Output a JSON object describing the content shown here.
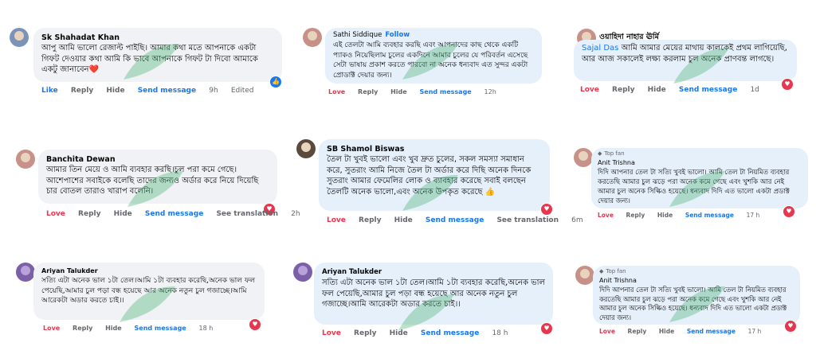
{
  "colors": {
    "love": "#e8364f",
    "link": "#1877f2",
    "muted": "#65676b",
    "bubble_grey": "#f0f2f5",
    "bubble_blue": "#e6f0fb"
  },
  "comments": [
    {
      "name": "Sk Shahadat Khan",
      "text": "আপু আমি ভালো রেজাল্ট পাইছি। আমার কথা মতে আপনাকে একটা গিফট দেওয়ার কথা আমি কি ভাবে আপনাকে গিফট টা দিবো আমাকে একটু জানাবেন❤️",
      "actions": {
        "react": "Like",
        "reply": "Reply",
        "hide": "Hide",
        "send": "Send message",
        "time": "9h",
        "edited": "Edited"
      },
      "reaction_icon": "like-icon"
    },
    {
      "name": "Sathi Siddique",
      "follow": "Follow",
      "text": "এই তেলটা আমি ব্যবহার করছি এবং আপনাদের কাছ থেকে একটি প্যাকও নিয়েছিলাম চুলের একদিনে আমার চুলের যে পরিবর্তন এসেছে সেটা ভাষায় প্রকাশ করতে পারবো না অনেক ধন্যবাদ এত সুন্দর একটা প্রোডাক্ট দেয়ার জন্য।",
      "actions": {
        "react": "Love",
        "reply": "Reply",
        "hide": "Hide",
        "send": "Send message",
        "time": "12h"
      }
    },
    {
      "name": "ওয়াহিদা নাহার ঊর্মি",
      "mention": "Sajal Das",
      "text": " আমি আমার মেয়ের মাথায় কালকেই প্রথম লাগিয়েছি, আর আজ সকালেই লক্ষ্য করলাম চুল অনেক প্রাণবন্ত লাগছে।",
      "actions": {
        "react": "Love",
        "reply": "Reply",
        "hide": "Hide",
        "send": "Send message",
        "time": "1d"
      },
      "reaction_icon": "love-icon"
    },
    {
      "name": "Banchita Dewan",
      "text": "আমার তিন মেয়ে ও আমি ব্যবহার করছি।চুল পরা কমে গেছে।আশেপাশের সবাইকে বলেছি তাদের জন্যও অর্ডার করে নিয়ে দিয়েছি চার বোতল তারাও খারাপ বলেনি।",
      "actions": {
        "react": "Love",
        "reply": "Reply",
        "hide": "Hide",
        "send": "Send message",
        "translate": "See translation",
        "time": "2h"
      },
      "reaction_icon": "love-icon"
    },
    {
      "name": "SB Shamol Biswas",
      "text": "তৈল টা খুবই ভালো এবং খুব দ্রুত চুলের, সকল সমস্যা সমাধান করে, সুতরাং আমি নিজে তৈল টা অর্ডার করে দিছি অনেক দিনকে সুতরাং আমার ফেমেলির লোক ও ব্যাবহার করেছে সবাই বলছেন তৈলটি অনেক ভালো,এবং অনেক উপকৃত করেছে 👍",
      "actions": {
        "react": "Love",
        "reply": "Reply",
        "hide": "Hide",
        "send": "Send message",
        "translate": "See translation",
        "time": "6m"
      },
      "reaction_icon": "love-icon"
    },
    {
      "badge": "Top fan",
      "name": "Anit Trishna",
      "text": "দিদি আপনার তেল টা সত্যি খুবই ভালো। আমি তেল টা নিয়মিত ব্যবহার করতেছি আমার চুল ঝড়ে পরা অনেক কমে গেছে এবং খুশকি আর নেই আমার চুল অনেক সিল্কিও হয়েছে। ধন্যবাদ দিদি এত ভালো একটা প্রডাক্ট দেয়ার জন্য।",
      "actions": {
        "react": "Love",
        "reply": "Reply",
        "hide": "Hide",
        "send": "Send message",
        "time": "17 h"
      },
      "reaction_icon": "love-icon"
    },
    {
      "name": "Ariyan Talukder",
      "text": "সত্যি এটা অনেক ভাল ১টা তেল।আমি ১টা ব্যবহার করেছি,অনেক ভাল ফল পেয়েছি,আমার চুল পড়া বন্ধ হয়েছে আর অনেক নতুন চুল গজাচ্ছে।আমি আরেকটা অডার করতে চাই।।",
      "actions": {
        "react": "Love",
        "reply": "Reply",
        "hide": "Hide",
        "send": "Send message",
        "time": "18 h"
      },
      "reaction_icon": "love-icon"
    },
    {
      "name": "Ariyan Talukder",
      "text": "সত্যি এটা অনেক ভাল ১টা তেল।আমি ১টা ব্যবহার করেছি,অনেক ভাল ফল পেয়েছি,আমার চুল পড়া বন্ধ হয়েছে আর অনেক নতুন চুল গজাচ্ছে।আমি আরেকটা অডার করতে চাই।।",
      "actions": {
        "react": "Love",
        "reply": "Reply",
        "hide": "Hide",
        "send": "Send message",
        "time": "18 h"
      },
      "reaction_icon": "love-icon"
    },
    {
      "badge": "Top fan",
      "name": "Anit Trishna",
      "text": "দিদি আপনার তেল টা সত্যি খুবই ভালো। আমি তেল টা নিয়মিত ব্যবহার করতেছি আমার চুল ঝড়ে পরা অনেক কমে গেছে এবং খুশকি আর নেই আমার চুল অনেক সিল্কিও হয়েছে। ধন্যবাদ দিদি এত ভালো একটা প্রডাক্ট দেয়ার জন্য।",
      "actions": {
        "react": "Love",
        "reply": "Reply",
        "hide": "Hide",
        "send": "Send message",
        "time": "17 h"
      },
      "reaction_icon": "love-icon"
    }
  ]
}
